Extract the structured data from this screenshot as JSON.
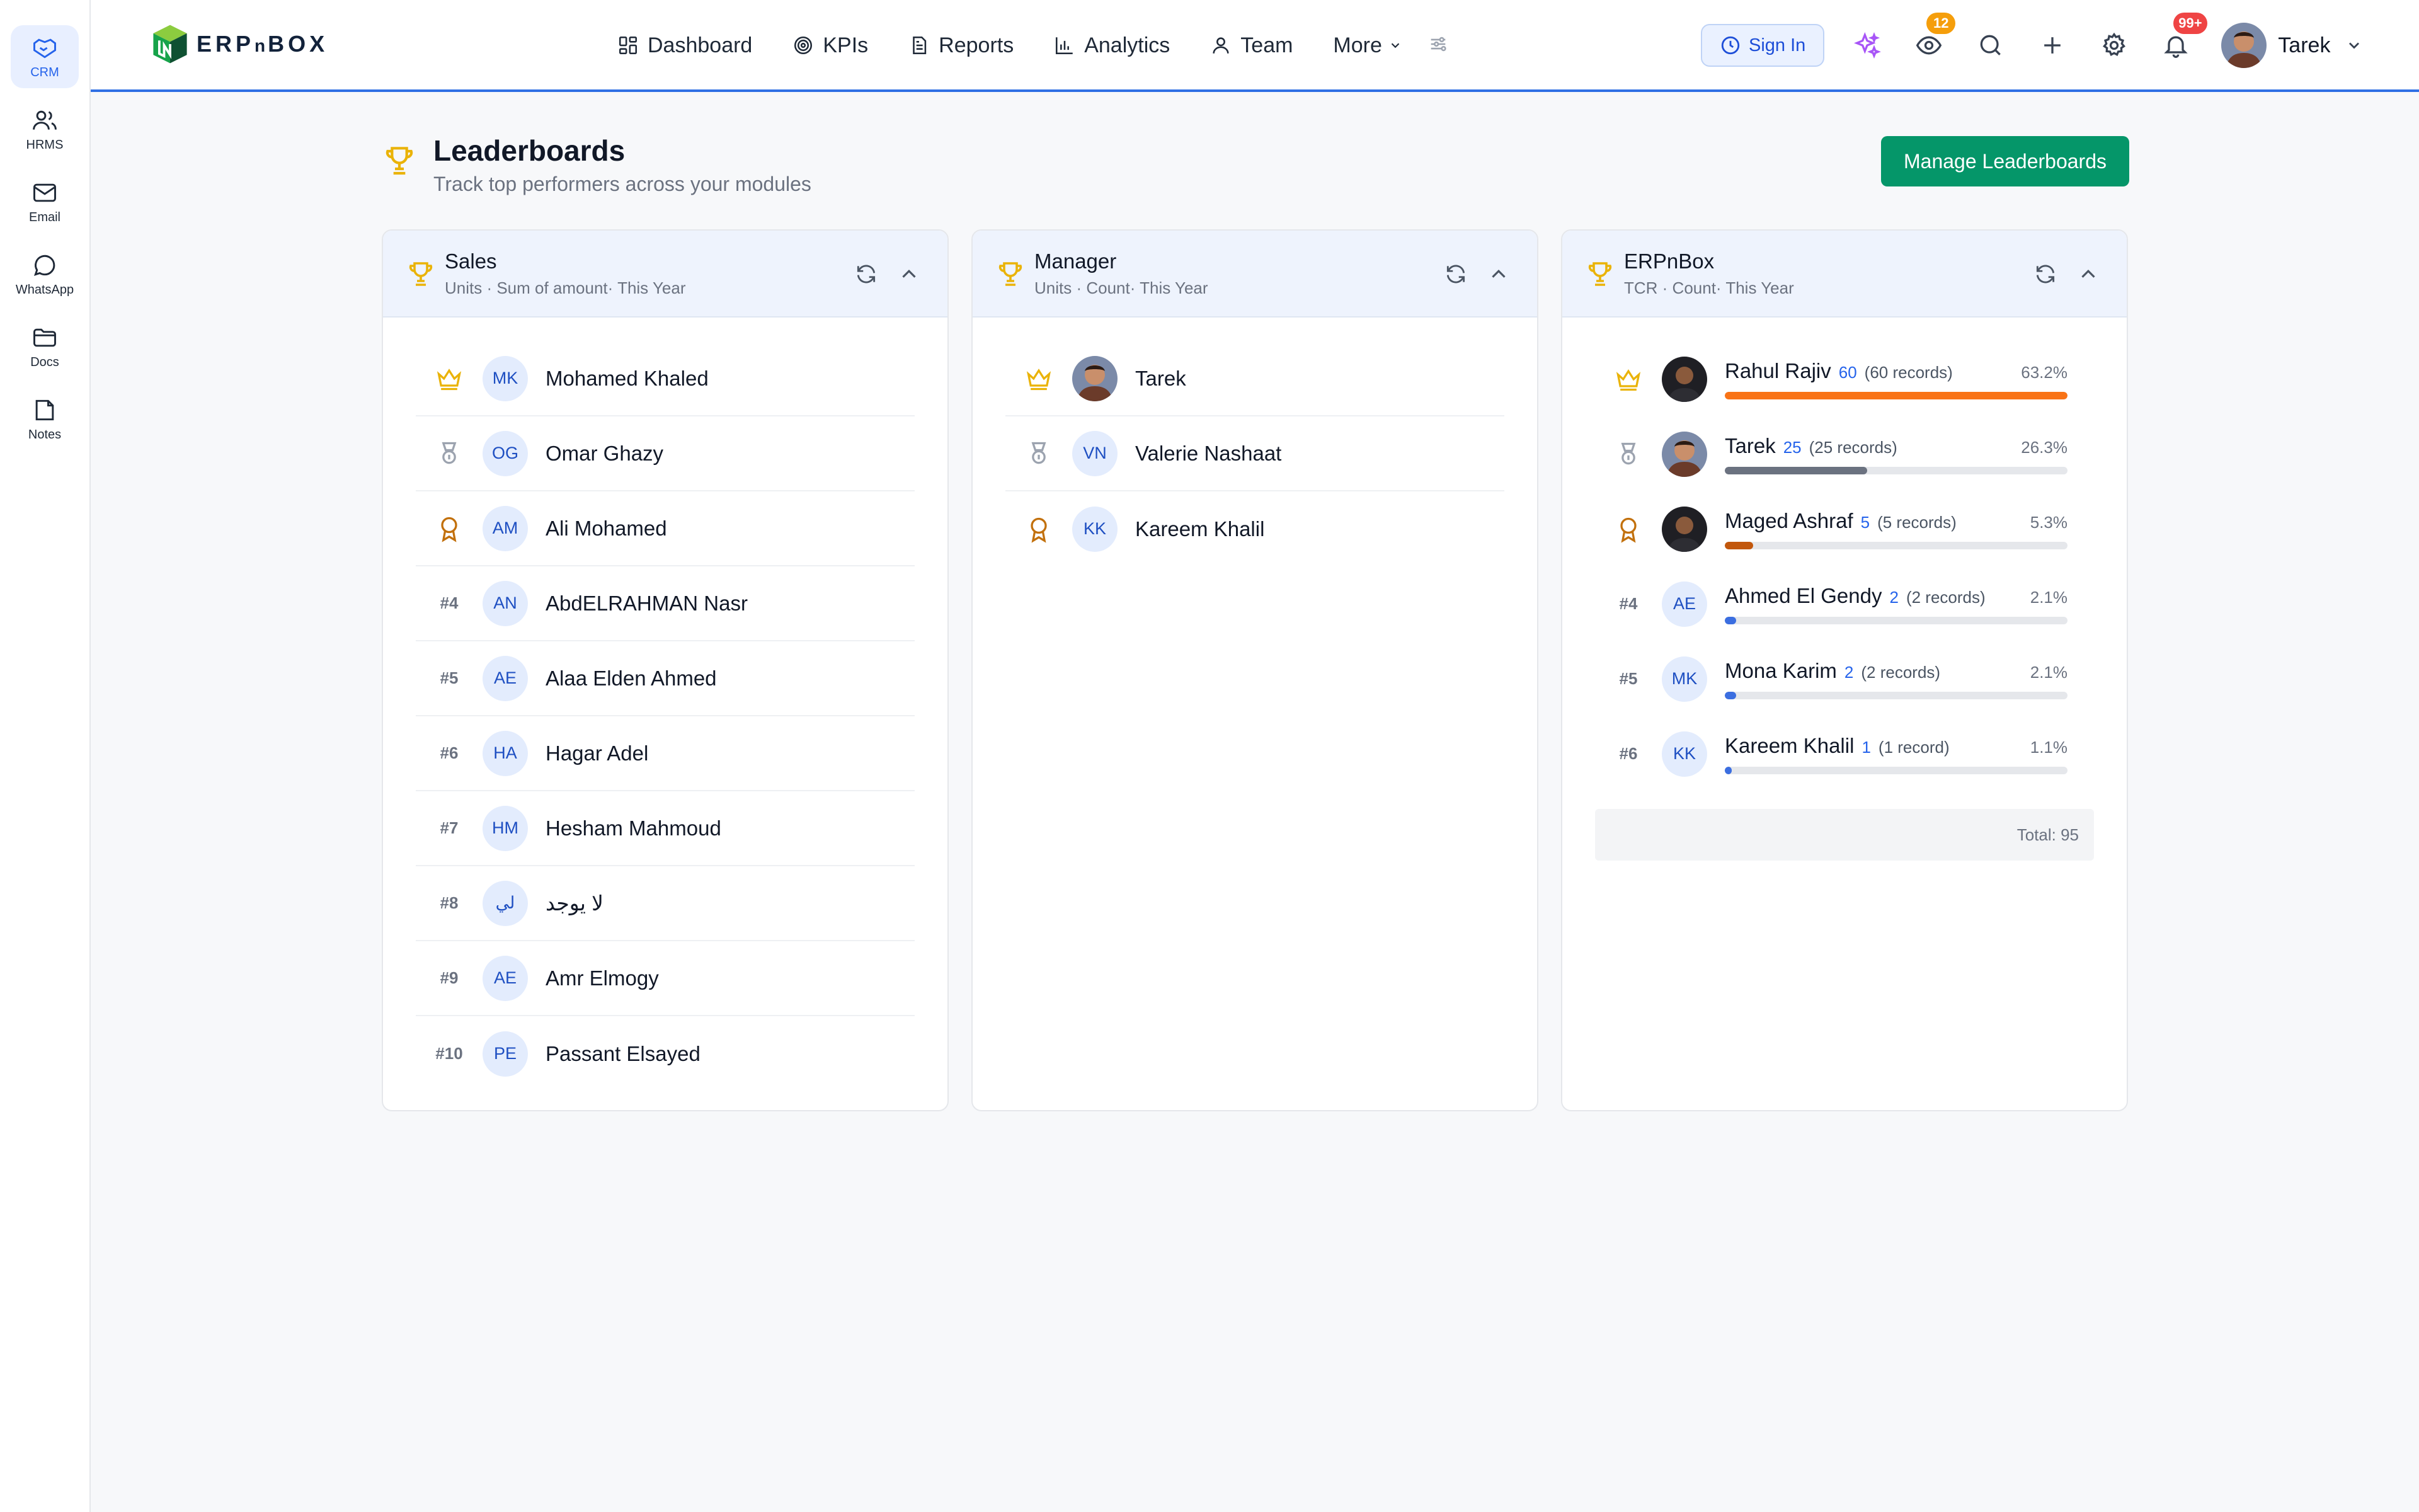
{
  "rail": [
    {
      "icon": "handshake-icon",
      "label": "CRM",
      "active": true
    },
    {
      "icon": "users-icon",
      "label": "HRMS"
    },
    {
      "icon": "mail-icon",
      "label": "Email"
    },
    {
      "icon": "whatsapp-icon",
      "label": "WhatsApp"
    },
    {
      "icon": "folder-icon",
      "label": "Docs"
    },
    {
      "icon": "note-icon",
      "label": "Notes"
    }
  ],
  "brand": {
    "logo_text_1": "ERP",
    "logo_text_2": "n",
    "logo_text_3": "BOX"
  },
  "nav": {
    "items": [
      {
        "icon": "dashboard-icon",
        "label": "Dashboard"
      },
      {
        "icon": "target-icon",
        "label": "KPIs"
      },
      {
        "icon": "report-icon",
        "label": "Reports"
      },
      {
        "icon": "bar-chart-icon",
        "label": "Analytics"
      },
      {
        "icon": "team-icon",
        "label": "Team"
      }
    ],
    "more_label": "More"
  },
  "header_actions": {
    "sign_in_label": "Sign In",
    "watch_badge": "12",
    "notifications_badge": "99+",
    "user_name": "Tarek"
  },
  "page": {
    "title": "Leaderboards",
    "subtitle": "Track top performers across your modules",
    "manage_label": "Manage Leaderboards"
  },
  "boards": {
    "sales": {
      "title": "Sales",
      "subtitle": "Units · Sum of amount· This Year",
      "rows": [
        {
          "rank": "",
          "rank_icon": "crown-icon",
          "initials": "MK",
          "name": "Mohamed Khaled"
        },
        {
          "rank": "",
          "rank_icon": "medal-icon",
          "initials": "OG",
          "name": "Omar Ghazy"
        },
        {
          "rank": "",
          "rank_icon": "award-icon",
          "initials": "AM",
          "name": "Ali Mohamed"
        },
        {
          "rank": "#4",
          "initials": "AN",
          "name": "AbdELRAHMAN Nasr"
        },
        {
          "rank": "#5",
          "initials": "AE",
          "name": "Alaa Elden Ahmed"
        },
        {
          "rank": "#6",
          "initials": "HA",
          "name": "Hagar Adel"
        },
        {
          "rank": "#7",
          "initials": "HM",
          "name": "Hesham Mahmoud"
        },
        {
          "rank": "#8",
          "initials": "لي",
          "name": "لا يوجد"
        },
        {
          "rank": "#9",
          "initials": "AE",
          "name": "Amr Elmogy"
        },
        {
          "rank": "#10",
          "initials": "PE",
          "name": "Passant Elsayed"
        }
      ]
    },
    "manager": {
      "title": "Manager",
      "subtitle": "Units · Count· This Year",
      "rows": [
        {
          "rank_icon": "crown-icon",
          "initials": "",
          "photo": true,
          "name": "Tarek"
        },
        {
          "rank_icon": "medal-icon",
          "initials": "VN",
          "name": "Valerie Nashaat"
        },
        {
          "rank_icon": "award-icon",
          "initials": "KK",
          "name": "Kareem Khalil"
        }
      ]
    },
    "erpnbox": {
      "title": "ERPnBox",
      "subtitle": "TCR · Count· This Year",
      "rows": [
        {
          "rank": "",
          "rank_icon": "crown-icon",
          "photo": "dark",
          "name": "Rahul Rajiv",
          "value": "60",
          "records": "(60 records)",
          "pct": "63.2%",
          "share": 1.0,
          "color": "#f97316"
        },
        {
          "rank": "",
          "rank_icon": "medal-icon",
          "photo": "tarek",
          "name": "Tarek",
          "value": "25",
          "records": "(25 records)",
          "pct": "26.3%",
          "share": 0.415,
          "color": "#6b7280"
        },
        {
          "rank": "",
          "rank_icon": "award-icon",
          "photo": "dark",
          "name": "Maged Ashraf",
          "value": "5",
          "records": "(5 records)",
          "pct": "5.3%",
          "share": 0.083,
          "color": "#c2570c"
        },
        {
          "rank": "#4",
          "initials": "AE",
          "name": "Ahmed El Gendy",
          "value": "2",
          "records": "(2 records)",
          "pct": "2.1%",
          "share": 0.033,
          "color": "#3b6ee0"
        },
        {
          "rank": "#5",
          "initials": "MK",
          "name": "Mona Karim",
          "value": "2",
          "records": "(2 records)",
          "pct": "2.1%",
          "share": 0.033,
          "color": "#3b6ee0"
        },
        {
          "rank": "#6",
          "initials": "KK",
          "name": "Kareem Khalil",
          "value": "1",
          "records": "(1 record)",
          "pct": "1.1%",
          "share": 0.017,
          "color": "#3b6ee0"
        }
      ],
      "total": "Total: 95"
    }
  },
  "colors": {
    "accent": "#2f6fe4",
    "gold": "#eab308",
    "bronze": "#c2700c",
    "silver": "#9ca3af",
    "success": "#059669"
  }
}
